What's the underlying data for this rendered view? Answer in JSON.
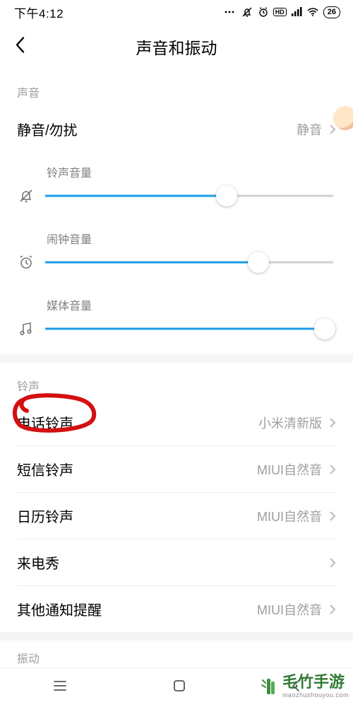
{
  "statusbar": {
    "time": "下午4:12",
    "battery_pct": "26"
  },
  "header": {
    "title": "声音和振动"
  },
  "sections": {
    "sound_label": "声音",
    "ringtone_label": "铃声",
    "vibration_label": "振动"
  },
  "rows": {
    "silent": {
      "title": "静音/勿扰",
      "value": "静音"
    },
    "phone_ring": {
      "title": "电话铃声",
      "value": "小米清新版"
    },
    "sms_ring": {
      "title": "短信铃声",
      "value": "MIUI自然音"
    },
    "calendar_ring": {
      "title": "日历铃声",
      "value": "MIUI自然音"
    },
    "call_show": {
      "title": "来电秀",
      "value": ""
    },
    "other_notify": {
      "title": "其他通知提醒",
      "value": "MIUI自然音"
    }
  },
  "sliders": {
    "ring": {
      "label": "铃声音量",
      "pct": 63
    },
    "alarm": {
      "label": "闹钟音量",
      "pct": 74
    },
    "media": {
      "label": "媒体音量",
      "pct": 97
    }
  },
  "colors": {
    "accent": "#1e9dea",
    "scribble": "#d40f12",
    "brand": "#317a34"
  },
  "watermark": {
    "name": "毛竹手游",
    "url": "maozhushouyou.com"
  },
  "icons": {
    "back": "back-icon",
    "bell_mute": "bell-mute-icon",
    "alarm": "alarm-clock-icon",
    "music": "music-note-icon",
    "chevron": "chevron-right-icon",
    "alarm_status": "alarm-clock-icon",
    "mute_status": "vibrate-mute-icon",
    "signal_hd": "signal-hd-icon",
    "signal": "signal-bars-icon",
    "wifi": "wifi-icon",
    "nav_recent": "nav-recent-icon",
    "nav_home": "nav-home-icon",
    "nav_back": "nav-back-icon"
  }
}
